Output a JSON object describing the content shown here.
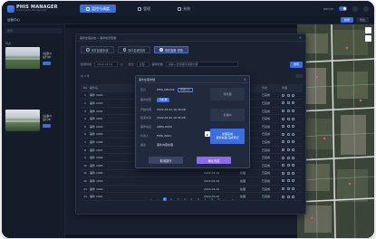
{
  "app": {
    "logo_name": "PHIS MANAGER",
    "logo_sub": "Smart Vision Management",
    "page_title": "运营中心"
  },
  "nav": [
    {
      "label": "监控与调度"
    },
    {
      "label": "管理"
    },
    {
      "label": "系统"
    }
  ],
  "topbar": {
    "user": "admin"
  },
  "subbar": {
    "btn1": "新增",
    "btn2": "导出"
  },
  "left_panel": {
    "search_placeholder": "搜索",
    "section_label": "列表",
    "items": [
      {
        "title": "[设备1]",
        "meta": "运行中"
      },
      {
        "title": "[设备2]",
        "meta": "运行中"
      }
    ]
  },
  "modal": {
    "title": "事件处理系统 > 事件检测查看",
    "close": "×",
    "tabs": [
      {
        "label": "事件处理系统"
      },
      {
        "label": "事件处理查看"
      },
      {
        "label": "事件查看 详情"
      }
    ],
    "filter": {
      "label1": "检测时间",
      "date_range": "2022.03.22",
      "label2": "区分",
      "select": "全部",
      "label3": "事件处理",
      "placeholder": "请输入检测事件或者内容",
      "search": "搜索"
    },
    "result_count": "共 5 件",
    "table": {
      "headers": [
        "NO",
        "事件名",
        "",
        "时间",
        "处理",
        "状态",
        "管理"
      ],
      "rows": [
        [
          "1",
          "事件 2004",
          "",
          "2022.03.22",
          "处理",
          "已完成"
        ],
        [
          "2",
          "事件 2003",
          "",
          "2022.03.22",
          "处理",
          "已完成"
        ],
        [
          "3",
          "事件 2002",
          "",
          "2022.03.22",
          "处理",
          "已完成"
        ],
        [
          "4",
          "事件 2001",
          "",
          "2022.03.22",
          "处理",
          "已完成"
        ],
        [
          "5",
          "事件 2000",
          "",
          "2022.03.22",
          "处理",
          "已完成"
        ],
        [
          "6",
          "事件 1999",
          "",
          "2022.03.22",
          "处理",
          "已完成"
        ],
        [
          "7",
          "事件 1998",
          "",
          "2022.03.22",
          "处理",
          "已完成"
        ],
        [
          "8",
          "事件 1997",
          "",
          "2022.03.22",
          "处理",
          "已完成"
        ],
        [
          "9",
          "事件 1996",
          "",
          "2022.03.22",
          "处理",
          "已完成"
        ],
        [
          "10",
          "事件 1995",
          "",
          "2022.03.22",
          "处理",
          "已完成"
        ],
        [
          "11",
          "事件 1994",
          "",
          "2022.03.22",
          "处理",
          "已完成"
        ],
        [
          "12",
          "事件 1993",
          "",
          "2022.03.22",
          "处理",
          "已完成"
        ],
        [
          "13",
          "事件 1992",
          "",
          "2022.03.22",
          "处理",
          "已完成"
        ],
        [
          "14",
          "事件 1991",
          "",
          "2022.03.22",
          "处理",
          "已完成"
        ]
      ]
    },
    "pager": [
      "«",
      "‹",
      "1",
      "2",
      "3",
      "4",
      "5",
      "6",
      "7",
      "8",
      "9",
      "›",
      "»"
    ]
  },
  "dialog": {
    "title": "事件处理详细",
    "close": "×",
    "rows": [
      {
        "k": "区分",
        "v": "PHIS_DEVICE",
        "tag": "详细信息"
      },
      {
        "k": "事件类型",
        "v": "",
        "badge": "待处理"
      },
      {
        "k": "开始时间",
        "v": "2022.03.22 10:30:08"
      },
      {
        "k": "结束时间",
        "v": "2022.03.22 10:35:08"
      },
      {
        "k": "事件地点",
        "v": "AREA-0003"
      },
      {
        "k": "负责人",
        "v": "PHIS_0001"
      },
      {
        "k": "备注",
        "v": "事件内容处理"
      }
    ],
    "side": [
      {
        "label": "待处理"
      },
      {
        "label": "处理中"
      },
      {
        "label": "处理完成",
        "sub": "事件处理 完成登记"
      }
    ],
    "cancel": "取消操作",
    "confirm": "确认完成"
  },
  "colors": {
    "accent": "#3b6fe0",
    "confirm": "#8b6cf0",
    "background": "#0e1420"
  }
}
